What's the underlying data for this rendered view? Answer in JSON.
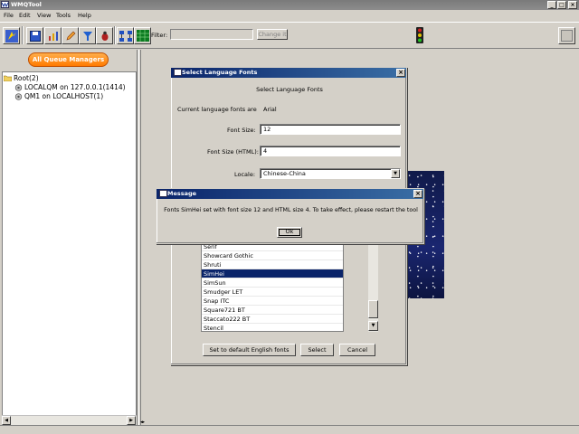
{
  "app": {
    "title": "WMQTool"
  },
  "menu": [
    "File",
    "Edit",
    "View",
    "Tools",
    "Help"
  ],
  "toolbar": {
    "filter_label": "Filter:",
    "filter_value": "",
    "change_button": "Change it"
  },
  "left": {
    "queue_managers_button": "All Queue Managers",
    "tree": {
      "root": "Root(2)",
      "children": [
        "LOCALQM on 127.0.0.1(1414)",
        "QM1 on LOCALHOST(1)"
      ]
    }
  },
  "font_dialog": {
    "title": "Select Language Fonts",
    "heading": "Select Language Fonts",
    "current_label": "Current language fonts are",
    "current_value": "Arial",
    "font_size_label": "Font Size:",
    "font_size_value": "12",
    "font_size_html_label": "Font Size (HTML):",
    "font_size_html_value": "4",
    "locale_label": "Locale:",
    "locale_value": "Chinese-China",
    "font_list": [
      "Serif",
      "Showcard Gothic",
      "Shruti",
      "SimHei",
      "SimSun",
      "Smudger LET",
      "Snap ITC",
      "Square721 BT",
      "Staccato222 BT",
      "Stencil"
    ],
    "selected_font": "SimHei",
    "buttons": {
      "default": "Set to default English fonts",
      "select": "Select",
      "cancel": "Cancel"
    }
  },
  "message_dialog": {
    "title": "Message",
    "text": "Fonts SimHei set with font size 12 and HTML size 4. To take effect, please restart the tool",
    "ok": "Ok"
  },
  "colors": {
    "accent": "#0a246a",
    "queue_button": "#ff8c1a",
    "chrome": "#d4d0c8"
  }
}
